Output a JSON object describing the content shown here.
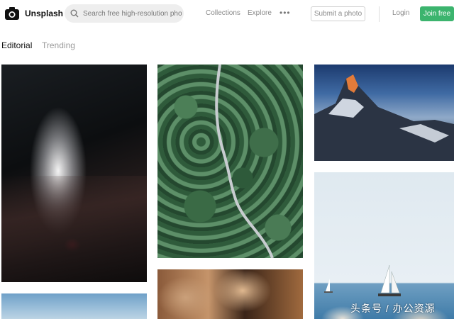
{
  "header": {
    "brand": "Unsplash",
    "search_placeholder": "Search free high-resolution photos",
    "nav": {
      "collections": "Collections",
      "explore": "Explore",
      "more": "•••"
    },
    "submit_label": "Submit a photo",
    "login_label": "Login",
    "join_label": "Join free",
    "join_color": "#3cb46e"
  },
  "tabs": [
    {
      "label": "Editorial",
      "active": true
    },
    {
      "label": "Trending",
      "active": false
    }
  ],
  "photos": [
    {
      "subject": "cave"
    },
    {
      "subject": "forest-road"
    },
    {
      "subject": "matterhorn"
    },
    {
      "subject": "sailboat-sea"
    },
    {
      "subject": "food"
    },
    {
      "subject": "sky"
    }
  ],
  "watermark": "头条号 / 办公资源"
}
